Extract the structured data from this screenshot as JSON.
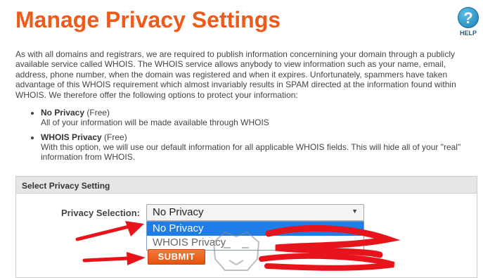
{
  "page": {
    "title": "Manage Privacy Settings",
    "help_label": "HELP",
    "help_glyph": "?"
  },
  "intro": "As with all domains and registrars, we are required to publish information concernining your domain through a publicly available service called WHOIS. The WHOIS service allows anybody to view information such as your name, email, address, phone number, when the domain was registered and when it expires. Unfortunately, spammers have taken advantage of this WHOIS requirement which almost invariably results in SPAM directed at the information found within WHOIS. We therefore offer the following options to protect your information:",
  "options": [
    {
      "name": "No Privacy",
      "price": "(Free)",
      "desc": "All of your information will be made available through WHOIS"
    },
    {
      "name": "WHOIS Privacy",
      "price": "(Free)",
      "desc": "With this option, we will use our default information for all applicable WHOIS fields. This will hide all of your \"real\" information from WHOIS."
    }
  ],
  "panel": {
    "heading": "Select Privacy Setting",
    "field_label": "Privacy Selection:",
    "selected": "No Privacy",
    "dropdown_options": [
      "No Privacy",
      "WHOIS Privacy"
    ],
    "submit_label": "SUBMIT"
  },
  "colors": {
    "title": "#ef5a1a",
    "submit": "#e4520e",
    "highlight": "#1e7de6",
    "annotation": "#e8141c"
  }
}
